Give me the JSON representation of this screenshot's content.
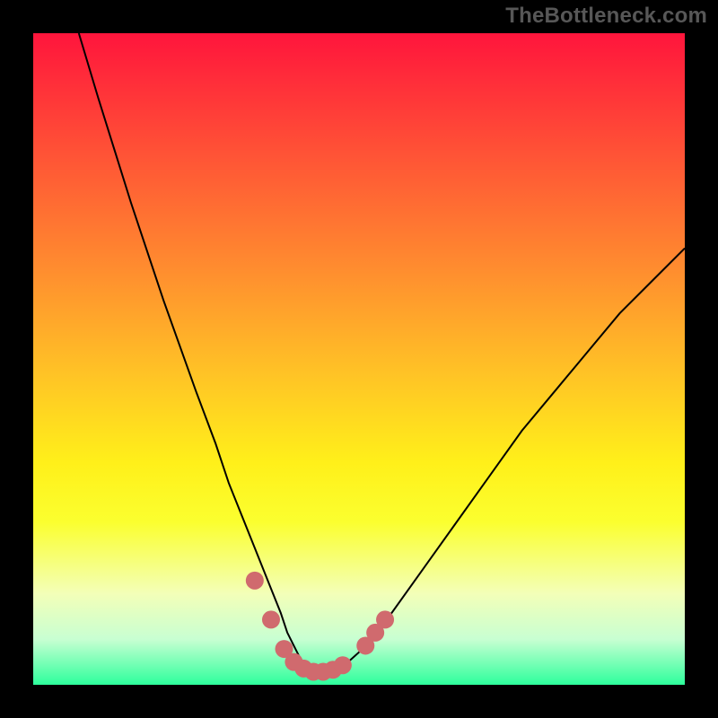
{
  "watermark": "TheBottleneck.com",
  "chart_data": {
    "type": "line",
    "title": "",
    "xlabel": "",
    "ylabel": "",
    "xlim": [
      0,
      100
    ],
    "ylim": [
      0,
      100
    ],
    "series": [
      {
        "name": "curve",
        "x": [
          7,
          10,
          15,
          20,
          25,
          28,
          30,
          32,
          34,
          36,
          38,
          39,
          40,
          41,
          42,
          43,
          44,
          45,
          46,
          48,
          50,
          55,
          60,
          65,
          70,
          75,
          80,
          85,
          90,
          95,
          100
        ],
        "y": [
          100,
          90,
          74,
          59,
          45,
          37,
          31,
          26,
          21,
          16,
          11,
          8,
          6,
          4,
          3,
          2.2,
          2,
          2,
          2.3,
          3.2,
          5,
          11,
          18,
          25,
          32,
          39,
          45,
          51,
          57,
          62,
          67
        ]
      }
    ],
    "markers": [
      {
        "x": 34,
        "y": 16
      },
      {
        "x": 36.5,
        "y": 10
      },
      {
        "x": 38.5,
        "y": 5.5
      },
      {
        "x": 40,
        "y": 3.5
      },
      {
        "x": 41.5,
        "y": 2.5
      },
      {
        "x": 43,
        "y": 2
      },
      {
        "x": 44.5,
        "y": 2
      },
      {
        "x": 46,
        "y": 2.3
      },
      {
        "x": 47.5,
        "y": 3
      },
      {
        "x": 51,
        "y": 6
      },
      {
        "x": 52.5,
        "y": 8
      },
      {
        "x": 54,
        "y": 10
      }
    ],
    "marker_color": "#d06a6e",
    "curve_color": "#000000",
    "gradient_stops": [
      {
        "pos": 0,
        "color": "#ff153c"
      },
      {
        "pos": 50,
        "color": "#ffc226"
      },
      {
        "pos": 75,
        "color": "#fbff2f"
      },
      {
        "pos": 100,
        "color": "#2dff9c"
      }
    ]
  }
}
